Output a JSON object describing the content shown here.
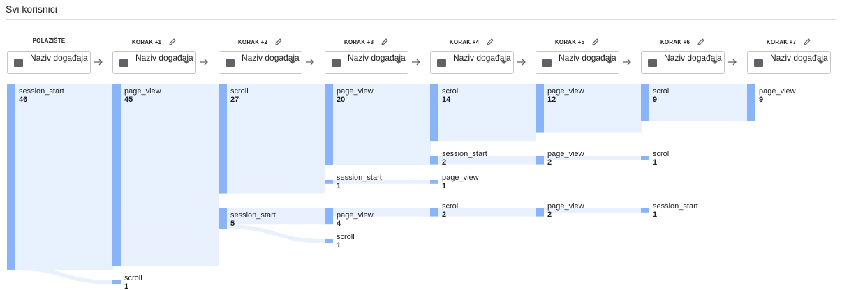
{
  "segment": "Svi korisnici",
  "dimension_label": "Naziv događaja",
  "steps": [
    {
      "label": "POLAZIŠTE",
      "editable": false
    },
    {
      "label": "KORAK +1",
      "editable": true
    },
    {
      "label": "KORAK +2",
      "editable": true
    },
    {
      "label": "KORAK +3",
      "editable": true
    },
    {
      "label": "KORAK +4",
      "editable": true
    },
    {
      "label": "KORAK +5",
      "editable": true
    },
    {
      "label": "KORAK +6",
      "editable": true
    },
    {
      "label": "KORAK +7",
      "editable": true
    }
  ],
  "colors": {
    "node": "#8ab4f8",
    "flow": "#e8f0fe",
    "text": "#202124"
  },
  "chart_data": {
    "type": "sankey",
    "title": "",
    "nodes": [
      {
        "id": "s0_session_start",
        "step": 0,
        "name": "session_start",
        "value": 46
      },
      {
        "id": "s1_page_view",
        "step": 1,
        "name": "page_view",
        "value": 45
      },
      {
        "id": "s1_scroll",
        "step": 1,
        "name": "scroll",
        "value": 1
      },
      {
        "id": "s2_scroll",
        "step": 2,
        "name": "scroll",
        "value": 27
      },
      {
        "id": "s2_session_start",
        "step": 2,
        "name": "session_start",
        "value": 5
      },
      {
        "id": "s3_page_view",
        "step": 3,
        "name": "page_view",
        "value": 20
      },
      {
        "id": "s3_session_start",
        "step": 3,
        "name": "session_start",
        "value": 1
      },
      {
        "id": "s3_page_view_b",
        "step": 3,
        "name": "page_view",
        "value": 4
      },
      {
        "id": "s3_scroll",
        "step": 3,
        "name": "scroll",
        "value": 1
      },
      {
        "id": "s4_scroll",
        "step": 4,
        "name": "scroll",
        "value": 14
      },
      {
        "id": "s4_session_start",
        "step": 4,
        "name": "session_start",
        "value": 2
      },
      {
        "id": "s4_page_view",
        "step": 4,
        "name": "page_view",
        "value": 1
      },
      {
        "id": "s4_scroll_b",
        "step": 4,
        "name": "scroll",
        "value": 2
      },
      {
        "id": "s5_page_view",
        "step": 5,
        "name": "page_view",
        "value": 12
      },
      {
        "id": "s5_page_view_b",
        "step": 5,
        "name": "page_view",
        "value": 2
      },
      {
        "id": "s5_page_view_c",
        "step": 5,
        "name": "page_view",
        "value": 2
      },
      {
        "id": "s6_scroll",
        "step": 6,
        "name": "scroll",
        "value": 9
      },
      {
        "id": "s6_scroll_b",
        "step": 6,
        "name": "scroll",
        "value": 1
      },
      {
        "id": "s6_session_start",
        "step": 6,
        "name": "session_start",
        "value": 1
      },
      {
        "id": "s7_page_view",
        "step": 7,
        "name": "page_view",
        "value": 9
      }
    ],
    "links": [
      {
        "source": "s0_session_start",
        "target": "s1_page_view",
        "value": 45
      },
      {
        "source": "s0_session_start",
        "target": "s1_scroll",
        "value": 1
      },
      {
        "source": "s1_page_view",
        "target": "s2_scroll",
        "value": 27
      },
      {
        "source": "s1_page_view",
        "target": "s2_session_start",
        "value": 5
      },
      {
        "source": "s2_scroll",
        "target": "s3_page_view",
        "value": 20
      },
      {
        "source": "s2_scroll",
        "target": "s3_session_start",
        "value": 1
      },
      {
        "source": "s2_session_start",
        "target": "s3_page_view_b",
        "value": 4
      },
      {
        "source": "s2_session_start",
        "target": "s3_scroll",
        "value": 1
      },
      {
        "source": "s3_page_view",
        "target": "s4_scroll",
        "value": 14
      },
      {
        "source": "s3_page_view",
        "target": "s4_session_start",
        "value": 2
      },
      {
        "source": "s3_session_start",
        "target": "s4_page_view",
        "value": 1
      },
      {
        "source": "s3_page_view_b",
        "target": "s4_scroll_b",
        "value": 2
      },
      {
        "source": "s4_scroll",
        "target": "s5_page_view",
        "value": 12
      },
      {
        "source": "s4_session_start",
        "target": "s5_page_view_b",
        "value": 2
      },
      {
        "source": "s4_scroll_b",
        "target": "s5_page_view_c",
        "value": 2
      },
      {
        "source": "s5_page_view",
        "target": "s6_scroll",
        "value": 9
      },
      {
        "source": "s5_page_view_b",
        "target": "s6_scroll_b",
        "value": 1
      },
      {
        "source": "s5_page_view_c",
        "target": "s6_session_start",
        "value": 1
      },
      {
        "source": "s6_scroll",
        "target": "s7_page_view",
        "value": 9
      }
    ]
  }
}
